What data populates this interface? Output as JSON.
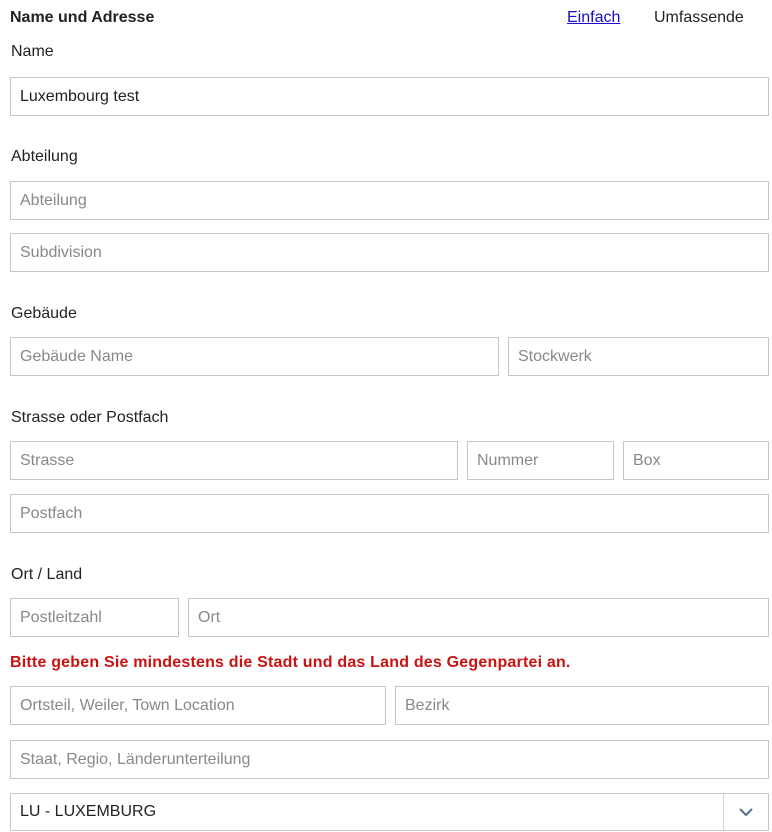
{
  "section": {
    "title": "Name und Adresse",
    "mode_simple": "Einfach",
    "mode_full": "Umfassende"
  },
  "name": {
    "label": "Name",
    "value": "Luxembourg test"
  },
  "department": {
    "label": "Abteilung",
    "department_placeholder": "Abteilung",
    "subdivision_placeholder": "Subdivision"
  },
  "building": {
    "label": "Gebäude",
    "name_placeholder": "Gebäude Name",
    "floor_placeholder": "Stockwerk"
  },
  "street": {
    "label": "Strasse oder Postfach",
    "street_placeholder": "Strasse",
    "number_placeholder": "Nummer",
    "box_placeholder": "Box",
    "pobox_placeholder": "Postfach"
  },
  "location": {
    "label": "Ort / Land",
    "postal_code_placeholder": "Postleitzahl",
    "city_placeholder": "Ort",
    "error_message": "Bitte geben Sie mindestens die Stadt und das Land des Gegenpartei an.",
    "town_location_placeholder": "Ortsteil, Weiler, Town Location",
    "district_placeholder": "Bezirk",
    "state_placeholder": "Staat, Regio, Länderunterteilung",
    "country_value": "LU - LUXEMBURG",
    "dropdown_icon": "chevron-down-icon"
  },
  "colors": {
    "link": "#1a0dcc",
    "error": "#cc1111",
    "border": "#c6c6c6",
    "placeholder": "#888888"
  }
}
